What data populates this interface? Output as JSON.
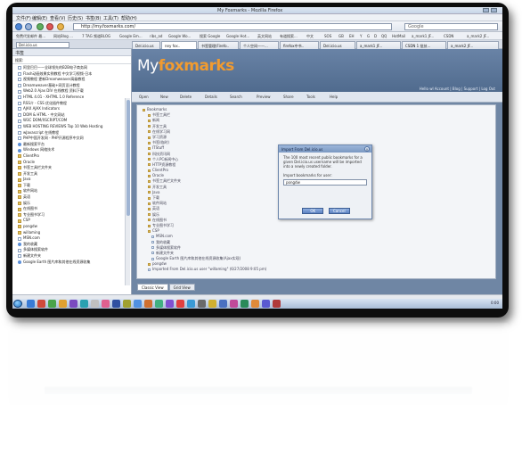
{
  "window": {
    "title": "My Foxmarks - Mozilla Firefox"
  },
  "menu": [
    "文件(F)",
    "编辑(E)",
    "查看(V)",
    "历史(S)",
    "书签(B)",
    "工具(T)",
    "帮助(H)"
  ],
  "nav": {
    "url": "http://my.foxmarks.com/",
    "search_placeholder": "Google"
  },
  "bookmarks_toolbar": [
    "免费代发邮件 最...",
    "网站Blog ...",
    "7 TAG 频道BLOG",
    "Google Em...",
    "ribs_ad",
    "Google Wo...",
    "搜索 Google",
    "Google Hot...",
    "英文网站",
    "有道搜索...",
    "中文",
    "SOS",
    "GB",
    "EH",
    "Y",
    "G",
    "D",
    "QQ",
    "HotMail",
    "a_mark1 JF...",
    "CSDN",
    "a_mark2 JF..."
  ],
  "tabs": [
    "Del.icio.us",
    "Del.icio.us",
    "ney fox..",
    "书签管理(Firefo..",
    "个人空间——...",
    "firefox中书..",
    "Del.icio.us",
    "a_mark1 JF...",
    "CSDN 1 批技...",
    "a_mark2 JF..."
  ],
  "sidebar": {
    "header": "书签",
    "search_label": "搜索:",
    "items": [
      {
        "text": "阿里巴巴——全球领先的B2B电子商务网",
        "type": "page"
      },
      {
        "text": "Flash动画效果实例教程 中文学习视频-日本",
        "type": "page"
      },
      {
        "text": "视频教程 更新Dreamweaver高级教程",
        "type": "page"
      },
      {
        "text": "Dreamweaver基础+网页设计教程",
        "type": "page"
      },
      {
        "text": "Web2.0 Ajax DIV 在线教程 资料下载",
        "type": "page"
      },
      {
        "text": "HTML 4.01 - XHTML 1.0 Reference",
        "type": "page"
      },
      {
        "text": "RSS介 - CSS 优化插件教程",
        "type": "page"
      },
      {
        "text": "AJAX AJAX Indicators",
        "type": "page"
      },
      {
        "text": "DOM & HTML - 中文网站",
        "type": "page"
      },
      {
        "text": "W3C DOM/XSCRIPT/COM",
        "type": "page"
      },
      {
        "text": "WEB HOSTING REVIEWS Top 10 Web Hosting",
        "type": "page"
      },
      {
        "text": "wJavascript 在线教程",
        "type": "page"
      },
      {
        "text": "PHP中国开发网 - PHP开源程序中文网",
        "type": "page"
      },
      {
        "text": "最新搜索平台",
        "type": "fav"
      },
      {
        "text": "Windows 网络技术",
        "type": "fav"
      },
      {
        "text": "ClientPro",
        "type": "folder"
      },
      {
        "text": "Oracle",
        "type": "folder"
      },
      {
        "text": "书签工具栏文件夹",
        "type": "folder"
      },
      {
        "text": "开发工具",
        "type": "folder"
      },
      {
        "text": "Java",
        "type": "folder"
      },
      {
        "text": "下载",
        "type": "folder"
      },
      {
        "text": "软件网站",
        "type": "folder"
      },
      {
        "text": "英语",
        "type": "folder"
      },
      {
        "text": "娱乐",
        "type": "folder"
      },
      {
        "text": "在线图书",
        "type": "folder"
      },
      {
        "text": "专业图书学习",
        "type": "folder"
      },
      {
        "text": "CSP",
        "type": "folder"
      },
      {
        "text": "pongdw",
        "type": "folder"
      },
      {
        "text": "willaming",
        "type": "folder"
      },
      {
        "text": "MSN.com",
        "type": "page"
      },
      {
        "text": "我的收藏",
        "type": "fav"
      },
      {
        "text": "多媒体搜索软件",
        "type": "page"
      },
      {
        "text": "新建文件夹",
        "type": "page"
      },
      {
        "text": "Google Earth 图片库和其他在线资源收集",
        "type": "fav"
      }
    ]
  },
  "foxmarks": {
    "logo_prefix": "My",
    "logo_brand": "foxmarks",
    "header_links": "Hello wl Account | Blog | Support | Log Out",
    "toolbar": [
      "Open",
      "New",
      "Delete",
      "Details",
      "Search",
      "Preview",
      "Share",
      "Tools",
      "Help"
    ],
    "tree": [
      "Bookmarks",
      "书签工具栏",
      "新闻",
      "开发工具",
      "在线学习网",
      "学习资源",
      "书签(临时)",
      "ITStuff",
      "科技资讯网",
      "个人PC新闻中心",
      "HTTP资源教程",
      "ClientPro",
      "Oracle",
      "书签工具栏文件夹",
      "开发工具",
      "Java",
      "下载",
      "软件网站",
      "英语",
      "娱乐",
      "在线图书",
      "专业图书学习",
      "CSP",
      "MSN.com",
      "我的收藏",
      "多媒体搜索软件",
      "新建文件夹",
      "Google Earth 图片库和其他在线资源收集(Ajax实现)",
      "pongdw",
      "Imported From Del.icio.us user \"willaming\" (6/27/2008 9:05 pm)"
    ],
    "bottom_tabs": [
      "Classic View",
      "Grid View"
    ]
  },
  "dialog": {
    "title": "Import From Del.icio.us",
    "message": "The 100 most recent public bookmarks for a given Del.icio.us username will be imported into a newly created folder.",
    "label": "Import bookmarks for user:",
    "input_value": "pongdw",
    "ok_label": "OK",
    "cancel_label": "Cancel"
  },
  "taskbar": {
    "tray_text": "0:00"
  },
  "colors": {
    "foxmarks_header": "#5a7397",
    "foxmarks_accent": "#f29b2f",
    "dialog_border": "#6c86ad"
  }
}
